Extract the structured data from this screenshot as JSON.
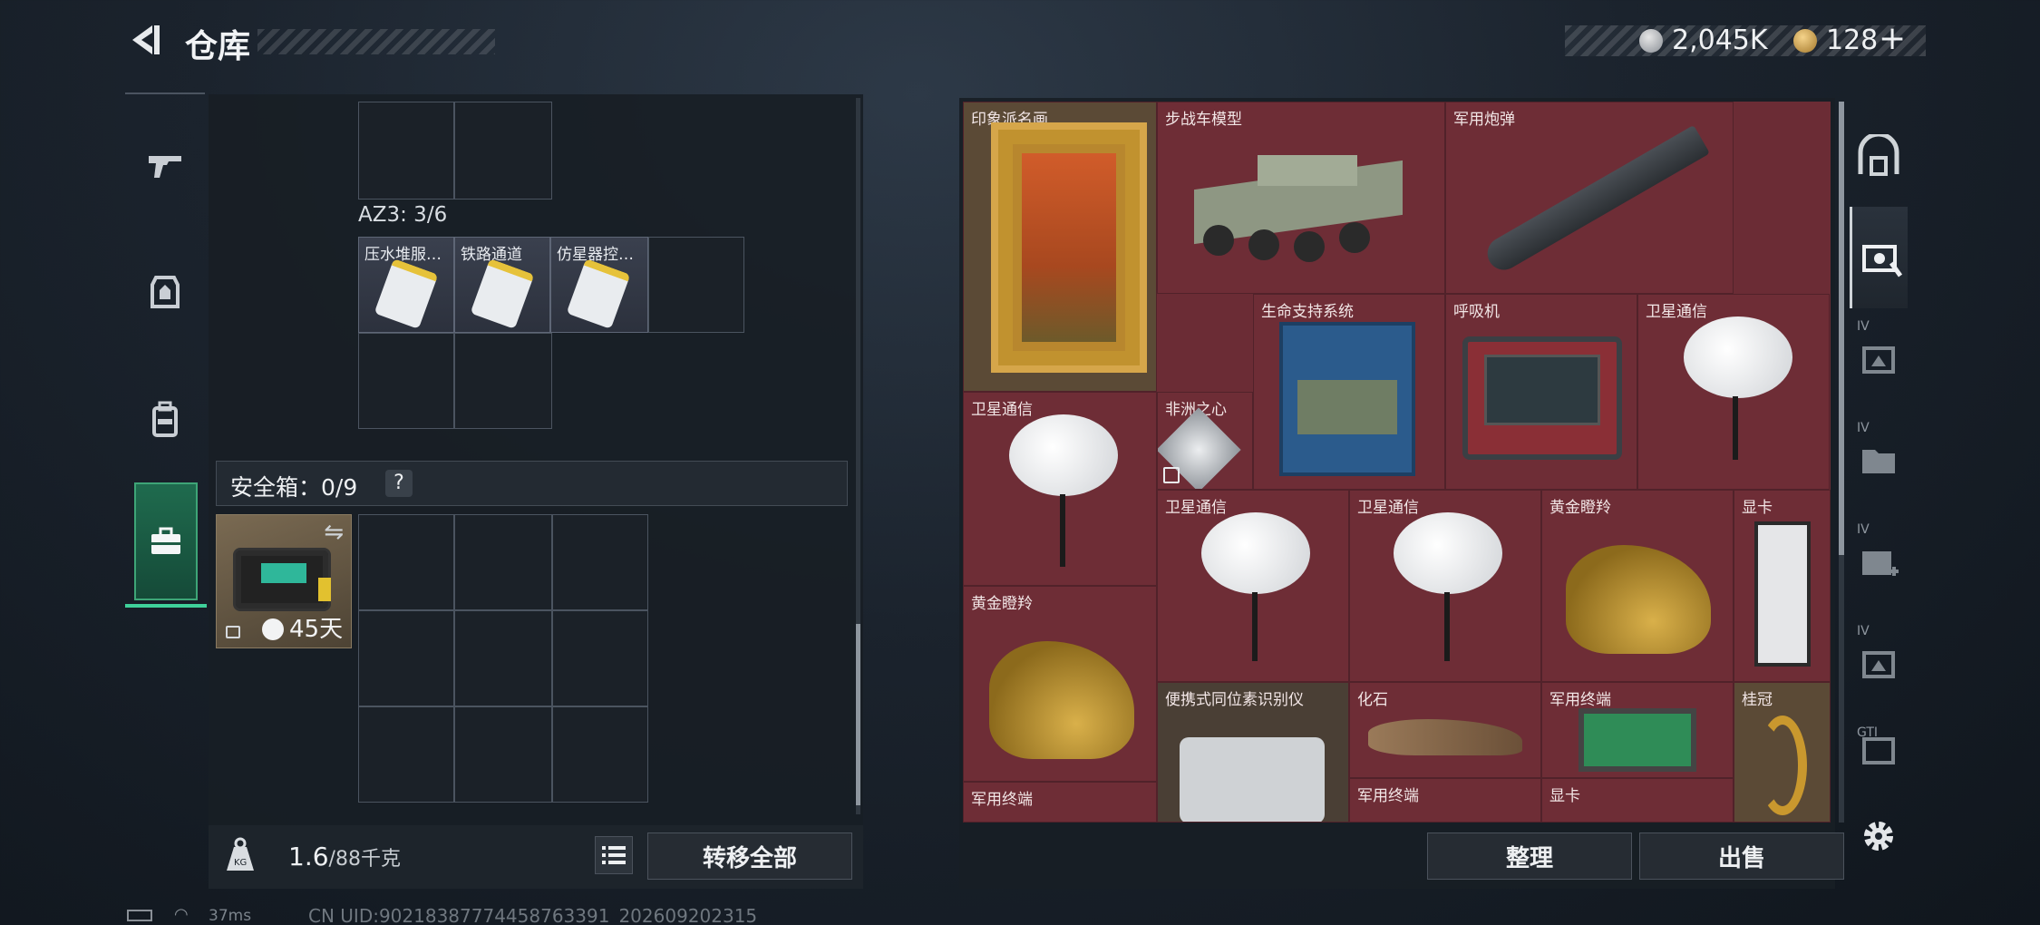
{
  "header": {
    "title": "仓库",
    "currency1": "2,045K",
    "currency2": "128",
    "add_label": "+"
  },
  "left_nav": {
    "tabs": [
      {
        "name": "weapon"
      },
      {
        "name": "armor"
      },
      {
        "name": "backpack"
      },
      {
        "name": "safebox",
        "active": true
      }
    ]
  },
  "container": {
    "az3_label": "AZ3: 3/6",
    "items": [
      {
        "label": "压水堆服…"
      },
      {
        "label": "铁路通道"
      },
      {
        "label": "仿星器控…"
      }
    ]
  },
  "safebox": {
    "title": "安全箱",
    "count": "0/9",
    "help": "?",
    "timer": "45天"
  },
  "footer": {
    "weight_current": "1.6",
    "weight_max": "/88千克",
    "transfer_all": "转移全部",
    "weight_icon_text": "KG"
  },
  "stash": {
    "items": [
      {
        "label": "印象派名画"
      },
      {
        "label": "步战车模型"
      },
      {
        "label": "军用炮弹"
      },
      {
        "label": "生命支持系统"
      },
      {
        "label": "呼吸机"
      },
      {
        "label": "卫星通信"
      },
      {
        "label": "卫星通信"
      },
      {
        "label": "非洲之心"
      },
      {
        "label": "卫星通信"
      },
      {
        "label": "卫星通信"
      },
      {
        "label": "黄金瞪羚"
      },
      {
        "label": "显卡"
      },
      {
        "label": "黄金瞪羚"
      },
      {
        "label": "便携式同位素识别仪"
      },
      {
        "label": "化石"
      },
      {
        "label": "军用终端"
      },
      {
        "label": "桂冠"
      },
      {
        "label": "军用终端"
      },
      {
        "label": "军用终端"
      },
      {
        "label": "显卡"
      }
    ],
    "sort_label": "整理",
    "sell_label": "出售"
  },
  "right_nav": {
    "tabs": [
      {
        "label": ""
      },
      {
        "label": ""
      },
      {
        "label": "IV"
      },
      {
        "label": "IV"
      },
      {
        "label": "IV"
      },
      {
        "label": "IV"
      },
      {
        "label": "GTI"
      }
    ]
  },
  "status_bar": {
    "ping": "37ms",
    "uid": "CN UID:90218387774458763391_202609202315"
  },
  "colors": {
    "accent_green": "#3fd19a",
    "stash_red": "#6b2c35"
  }
}
